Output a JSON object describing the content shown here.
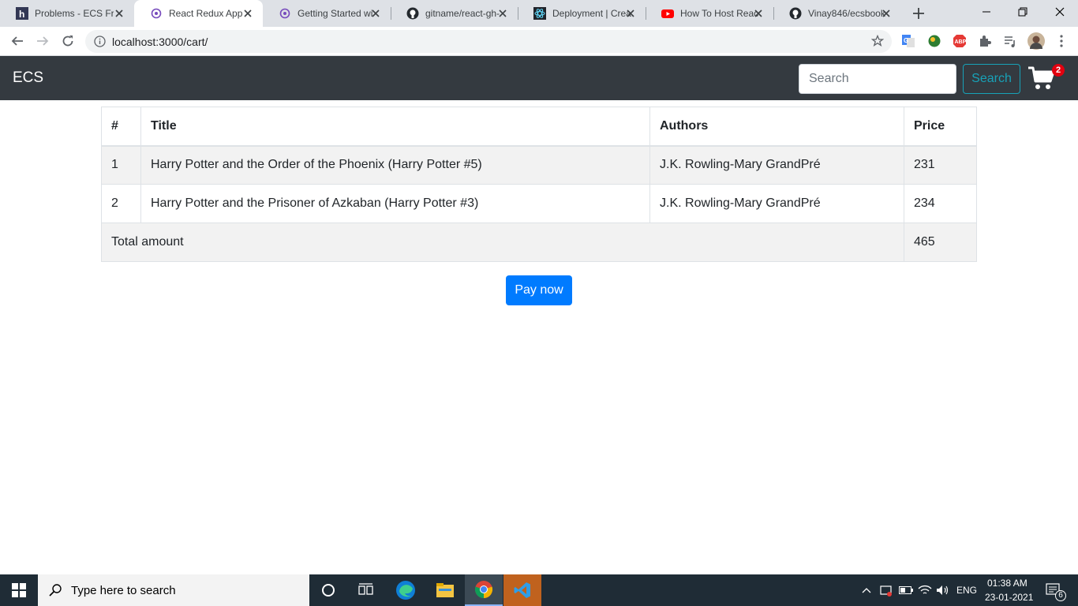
{
  "browser": {
    "tabs": [
      {
        "title": "Problems - ECS Fr",
        "icon": "hackerearth-icon"
      },
      {
        "title": "React Redux App",
        "icon": "redux-icon"
      },
      {
        "title": "Getting Started wi",
        "icon": "redux-icon"
      },
      {
        "title": "gitname/react-gh-",
        "icon": "github-icon"
      },
      {
        "title": "Deployment | Crea",
        "icon": "react-icon"
      },
      {
        "title": "How To Host Reac",
        "icon": "youtube-icon"
      },
      {
        "title": "Vinay846/ecsbook",
        "icon": "github-icon"
      }
    ],
    "active_tab": 1,
    "url": "localhost:3000/cart/"
  },
  "navbar": {
    "brand": "ECS",
    "search_placeholder": "Search",
    "search_button": "Search",
    "cart_count": "2"
  },
  "cart_table": {
    "headers": [
      "#",
      "Title",
      "Authors",
      "Price"
    ],
    "rows": [
      {
        "num": "1",
        "title": "Harry Potter and the Order of the Phoenix (Harry Potter #5)",
        "authors": "J.K. Rowling-Mary GrandPré",
        "price": "231"
      },
      {
        "num": "2",
        "title": "Harry Potter and the Prisoner of Azkaban (Harry Potter #3)",
        "authors": "J.K. Rowling-Mary GrandPré",
        "price": "234"
      }
    ],
    "total_label": "Total amount",
    "total_value": "465"
  },
  "pay_button": "Pay now",
  "taskbar": {
    "search_placeholder": "Type here to search",
    "language": "ENG",
    "time": "01:38 AM",
    "date": "23-01-2021",
    "notification_count": "6"
  },
  "colors": {
    "navbar_bg": "#343a40",
    "search_button": "#17a2b8",
    "pay_button": "#007bff",
    "cart_badge": "#e3000f"
  }
}
